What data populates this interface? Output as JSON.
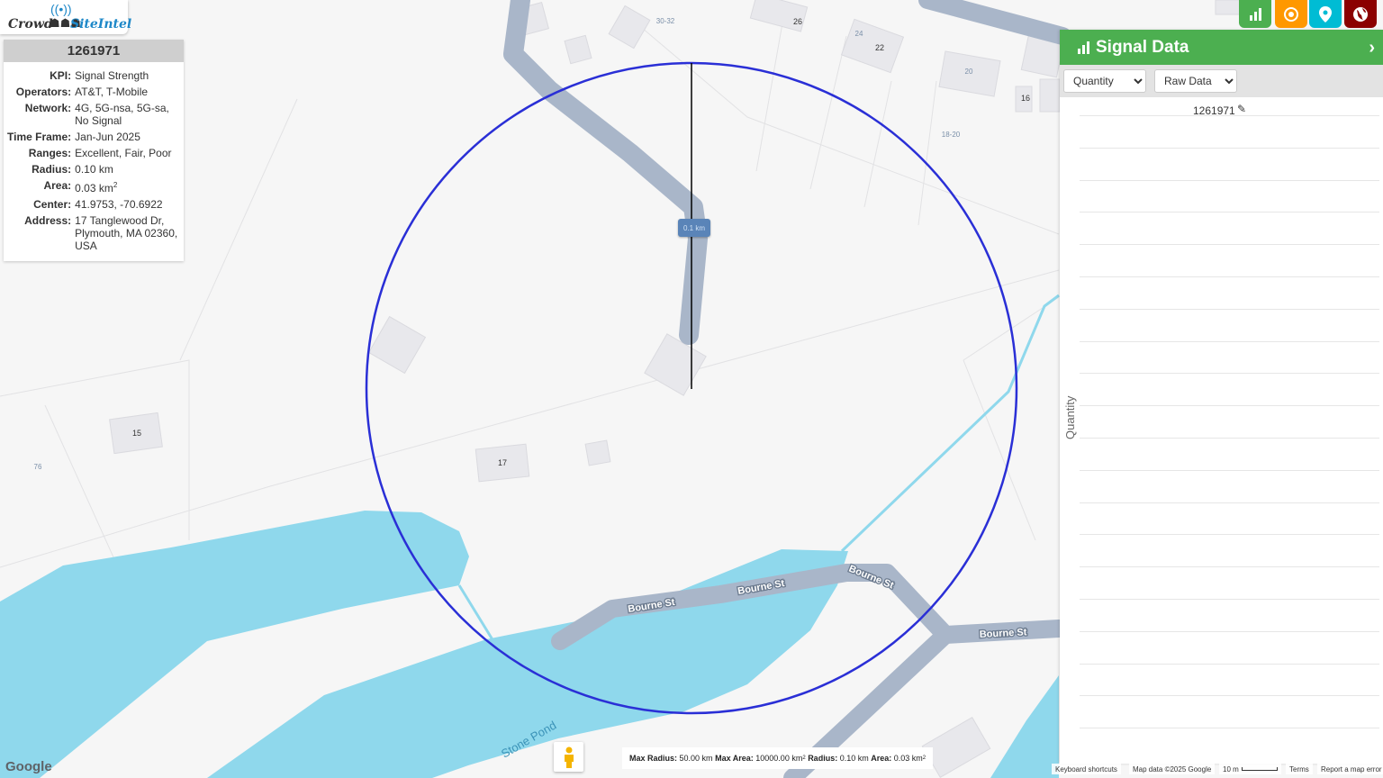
{
  "logo": {
    "crowd": "Crowd",
    "site": "SiteIntel"
  },
  "info": {
    "title": "1261971",
    "rows": [
      {
        "k": "KPI:",
        "v": "Signal Strength"
      },
      {
        "k": "Operators:",
        "v": "AT&T, T-Mobile"
      },
      {
        "k": "Network:",
        "v": "4G, 5G-nsa, 5G-sa, No Signal"
      },
      {
        "k": "Time Frame:",
        "v": "Jan-Jun 2025"
      },
      {
        "k": "Ranges:",
        "v": "Excellent, Fair, Poor"
      },
      {
        "k": "Radius:",
        "v": "0.10 km"
      },
      {
        "k": "Area:",
        "v": "0.03 km"
      },
      {
        "k": "Center:",
        "v": "41.9753, -70.6922"
      },
      {
        "k": "Address:",
        "v": "17 Tanglewood Dr, Plymouth, MA 02360, USA"
      }
    ],
    "area_sup": "2"
  },
  "toolbar": {
    "buttons": [
      {
        "name": "chart-button",
        "icon": "bar-chart-icon",
        "color": "#4caf50"
      },
      {
        "name": "target-button",
        "icon": "target-icon",
        "color": "#ff9800"
      },
      {
        "name": "location-button",
        "icon": "map-pin-icon",
        "color": "#00bcd4"
      },
      {
        "name": "globe-button",
        "icon": "globe-icon",
        "color": "#8b0000"
      }
    ]
  },
  "signal_panel": {
    "title": "Signal Data",
    "select1": {
      "value": "Quantity",
      "options": [
        "Quantity"
      ]
    },
    "select2": {
      "value": "Raw Data",
      "options": [
        "Raw Data"
      ]
    },
    "chart_title": "1261971",
    "y_label": "Quantity"
  },
  "measure_label": "0.1 km",
  "map_labels": {
    "bourne1": "Bourne St",
    "bourne2": "Bourne St",
    "bourne3": "Bourne St",
    "bourne4": "Bourne St",
    "pond": "Stone Pond",
    "h15": "15",
    "h17": "17",
    "h76": "76",
    "h26": "26",
    "h24": "24",
    "h22": "22",
    "h20": "20",
    "h16": "16",
    "h1820": "18-20",
    "h3032": "30-32"
  },
  "bottom_bar": {
    "max_radius_k": "Max Radius:",
    "max_radius_v": "50.00 km",
    "max_area_k": "Max Area:",
    "max_area_v": "10000.00 km",
    "radius_k": "Radius:",
    "radius_v": "0.10 km",
    "area_k": "Area:",
    "area_v": "0.03 km",
    "sup": "2"
  },
  "footer": {
    "google": "Google",
    "shortcuts": "Keyboard shortcuts",
    "mapdata": "Map data ©2025 Google",
    "scale": "10 m",
    "terms": "Terms",
    "report": "Report a map error"
  },
  "colors": {
    "water": "#8fd8ec",
    "road": "#a9b6c9",
    "circle": "#2a2fd6",
    "panel_green": "#4caf50"
  }
}
